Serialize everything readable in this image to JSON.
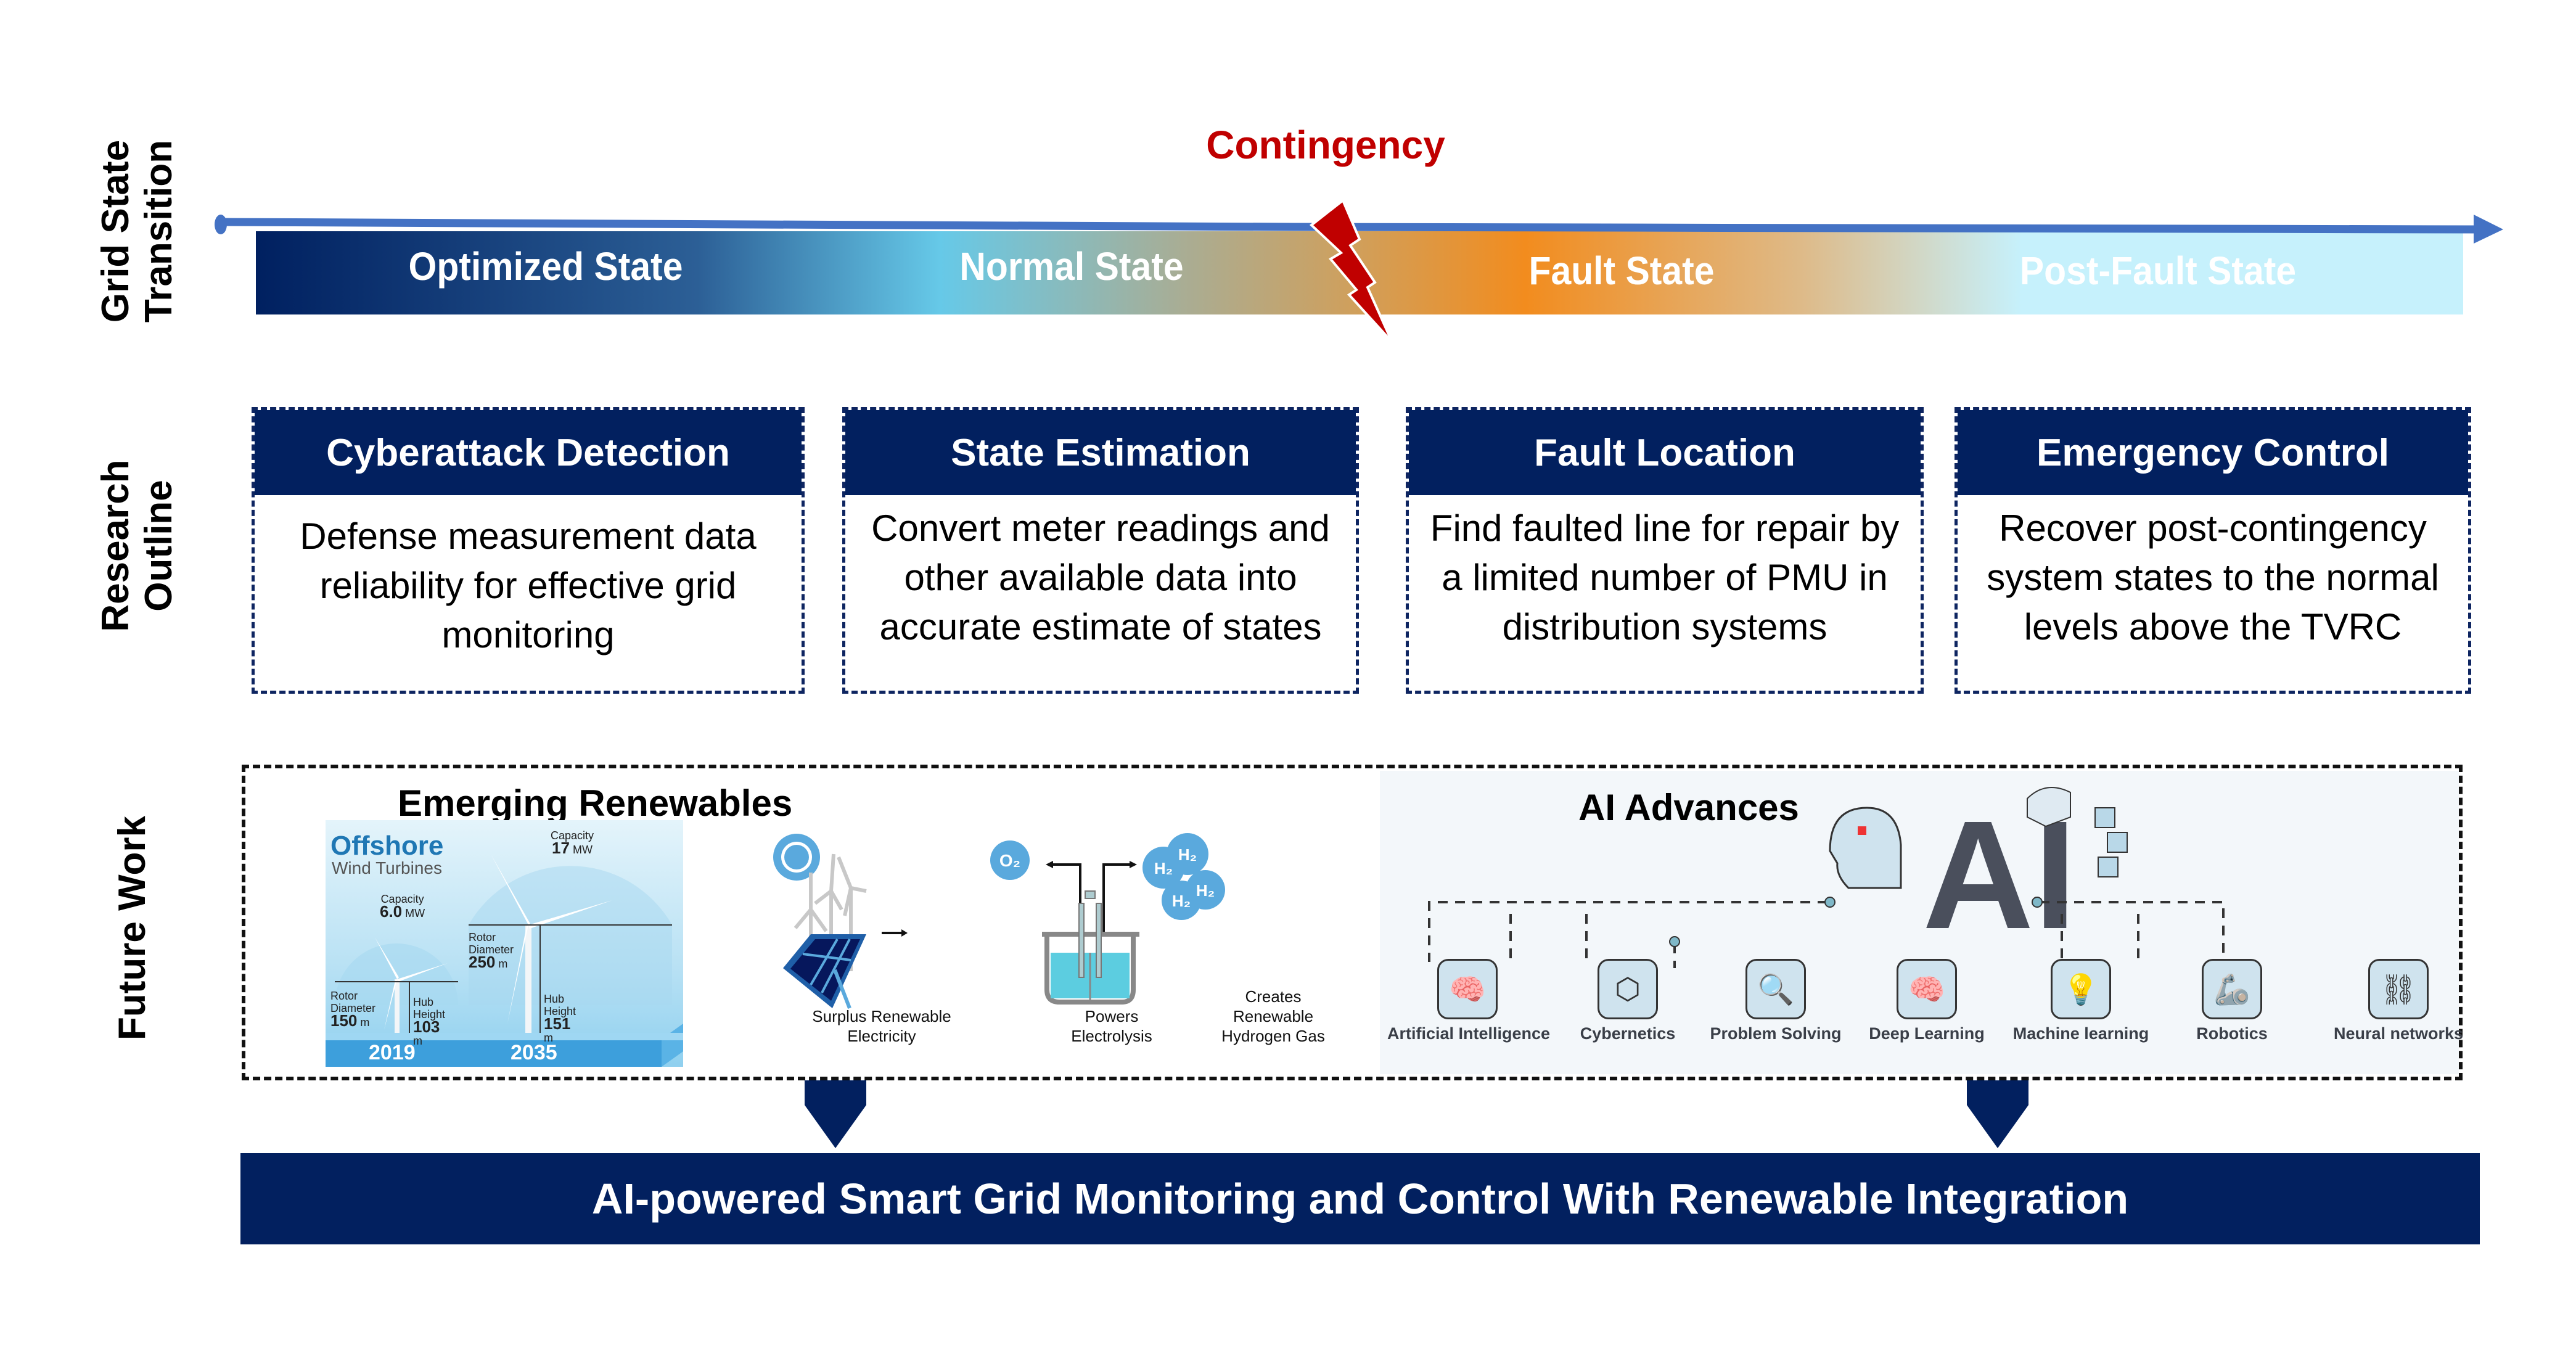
{
  "rows": {
    "grid_state": "Grid State\nTransition",
    "grid_state_line1": "Grid State",
    "grid_state_line2": "Transition",
    "research_line1": "Research",
    "research_line2": "Outline",
    "future_work": "Future Work"
  },
  "timeline": {
    "event": "Contingency",
    "states": [
      "Optimized State",
      "Normal State",
      "Fault State",
      "Post-Fault State"
    ],
    "colors": {
      "line": "#4472c4",
      "gradient": [
        "#002060",
        "#63c8e6",
        "#f28c1e",
        "#c6f1fc"
      ],
      "bolt": "#c00000"
    }
  },
  "research": [
    {
      "title": "Cyberattack Detection",
      "body": "Defense measurement data reliability for effective grid monitoring"
    },
    {
      "title": "State Estimation",
      "body": "Convert meter readings and other available data into accurate estimate of states"
    },
    {
      "title": "Fault Location",
      "body": "Find faulted line for repair by a limited number of PMU in distribution systems"
    },
    {
      "title": "Emergency Control",
      "body": "Recover post-contingency system states to the normal levels above the TVRC"
    }
  ],
  "future": {
    "renewables": {
      "title": "Emerging Renewables",
      "offshore": {
        "heading": "Offshore",
        "subheading": "Wind Turbines",
        "turbines": [
          {
            "year": "2019",
            "capacity_label": "Capacity",
            "capacity": "6.0",
            "capacity_unit": "MW",
            "rotor_label": "Rotor Diameter",
            "rotor": "150",
            "rotor_unit": "m",
            "hub_label": "Hub Height",
            "hub": "103",
            "hub_unit": "m"
          },
          {
            "year": "2035",
            "capacity_label": "Capacity",
            "capacity": "17",
            "capacity_unit": "MW",
            "rotor_label": "Rotor Diameter",
            "rotor": "250",
            "rotor_unit": "m",
            "hub_label": "Hub Height",
            "hub": "151",
            "hub_unit": "m"
          }
        ]
      },
      "hydrogen": {
        "steps": [
          "Surplus Renewable Electricity",
          "Powers Electrolysis",
          "Creates Renewable Hydrogen Gas"
        ],
        "molecules": [
          "O2",
          "H2",
          "H2",
          "H2",
          "H2"
        ]
      }
    },
    "ai": {
      "title": "AI Advances",
      "logo": "AI",
      "items": [
        "Artificial Intelligence",
        "Cybernetics",
        "Problem Solving",
        "Deep Learning",
        "Machine learning",
        "Robotics",
        "Neural networks"
      ]
    }
  },
  "banner": "AI-powered Smart Grid Monitoring and Control With Renewable Integration"
}
